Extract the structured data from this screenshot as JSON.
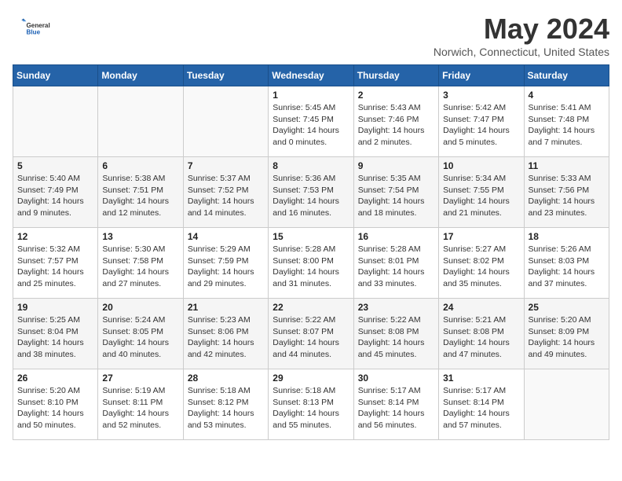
{
  "logo": {
    "general": "General",
    "blue": "Blue"
  },
  "header": {
    "month": "May 2024",
    "location": "Norwich, Connecticut, United States"
  },
  "weekdays": [
    "Sunday",
    "Monday",
    "Tuesday",
    "Wednesday",
    "Thursday",
    "Friday",
    "Saturday"
  ],
  "weeks": [
    [
      {
        "day": "",
        "info": ""
      },
      {
        "day": "",
        "info": ""
      },
      {
        "day": "",
        "info": ""
      },
      {
        "day": "1",
        "info": "Sunrise: 5:45 AM\nSunset: 7:45 PM\nDaylight: 14 hours\nand 0 minutes."
      },
      {
        "day": "2",
        "info": "Sunrise: 5:43 AM\nSunset: 7:46 PM\nDaylight: 14 hours\nand 2 minutes."
      },
      {
        "day": "3",
        "info": "Sunrise: 5:42 AM\nSunset: 7:47 PM\nDaylight: 14 hours\nand 5 minutes."
      },
      {
        "day": "4",
        "info": "Sunrise: 5:41 AM\nSunset: 7:48 PM\nDaylight: 14 hours\nand 7 minutes."
      }
    ],
    [
      {
        "day": "5",
        "info": "Sunrise: 5:40 AM\nSunset: 7:49 PM\nDaylight: 14 hours\nand 9 minutes."
      },
      {
        "day": "6",
        "info": "Sunrise: 5:38 AM\nSunset: 7:51 PM\nDaylight: 14 hours\nand 12 minutes."
      },
      {
        "day": "7",
        "info": "Sunrise: 5:37 AM\nSunset: 7:52 PM\nDaylight: 14 hours\nand 14 minutes."
      },
      {
        "day": "8",
        "info": "Sunrise: 5:36 AM\nSunset: 7:53 PM\nDaylight: 14 hours\nand 16 minutes."
      },
      {
        "day": "9",
        "info": "Sunrise: 5:35 AM\nSunset: 7:54 PM\nDaylight: 14 hours\nand 18 minutes."
      },
      {
        "day": "10",
        "info": "Sunrise: 5:34 AM\nSunset: 7:55 PM\nDaylight: 14 hours\nand 21 minutes."
      },
      {
        "day": "11",
        "info": "Sunrise: 5:33 AM\nSunset: 7:56 PM\nDaylight: 14 hours\nand 23 minutes."
      }
    ],
    [
      {
        "day": "12",
        "info": "Sunrise: 5:32 AM\nSunset: 7:57 PM\nDaylight: 14 hours\nand 25 minutes."
      },
      {
        "day": "13",
        "info": "Sunrise: 5:30 AM\nSunset: 7:58 PM\nDaylight: 14 hours\nand 27 minutes."
      },
      {
        "day": "14",
        "info": "Sunrise: 5:29 AM\nSunset: 7:59 PM\nDaylight: 14 hours\nand 29 minutes."
      },
      {
        "day": "15",
        "info": "Sunrise: 5:28 AM\nSunset: 8:00 PM\nDaylight: 14 hours\nand 31 minutes."
      },
      {
        "day": "16",
        "info": "Sunrise: 5:28 AM\nSunset: 8:01 PM\nDaylight: 14 hours\nand 33 minutes."
      },
      {
        "day": "17",
        "info": "Sunrise: 5:27 AM\nSunset: 8:02 PM\nDaylight: 14 hours\nand 35 minutes."
      },
      {
        "day": "18",
        "info": "Sunrise: 5:26 AM\nSunset: 8:03 PM\nDaylight: 14 hours\nand 37 minutes."
      }
    ],
    [
      {
        "day": "19",
        "info": "Sunrise: 5:25 AM\nSunset: 8:04 PM\nDaylight: 14 hours\nand 38 minutes."
      },
      {
        "day": "20",
        "info": "Sunrise: 5:24 AM\nSunset: 8:05 PM\nDaylight: 14 hours\nand 40 minutes."
      },
      {
        "day": "21",
        "info": "Sunrise: 5:23 AM\nSunset: 8:06 PM\nDaylight: 14 hours\nand 42 minutes."
      },
      {
        "day": "22",
        "info": "Sunrise: 5:22 AM\nSunset: 8:07 PM\nDaylight: 14 hours\nand 44 minutes."
      },
      {
        "day": "23",
        "info": "Sunrise: 5:22 AM\nSunset: 8:08 PM\nDaylight: 14 hours\nand 45 minutes."
      },
      {
        "day": "24",
        "info": "Sunrise: 5:21 AM\nSunset: 8:08 PM\nDaylight: 14 hours\nand 47 minutes."
      },
      {
        "day": "25",
        "info": "Sunrise: 5:20 AM\nSunset: 8:09 PM\nDaylight: 14 hours\nand 49 minutes."
      }
    ],
    [
      {
        "day": "26",
        "info": "Sunrise: 5:20 AM\nSunset: 8:10 PM\nDaylight: 14 hours\nand 50 minutes."
      },
      {
        "day": "27",
        "info": "Sunrise: 5:19 AM\nSunset: 8:11 PM\nDaylight: 14 hours\nand 52 minutes."
      },
      {
        "day": "28",
        "info": "Sunrise: 5:18 AM\nSunset: 8:12 PM\nDaylight: 14 hours\nand 53 minutes."
      },
      {
        "day": "29",
        "info": "Sunrise: 5:18 AM\nSunset: 8:13 PM\nDaylight: 14 hours\nand 55 minutes."
      },
      {
        "day": "30",
        "info": "Sunrise: 5:17 AM\nSunset: 8:14 PM\nDaylight: 14 hours\nand 56 minutes."
      },
      {
        "day": "31",
        "info": "Sunrise: 5:17 AM\nSunset: 8:14 PM\nDaylight: 14 hours\nand 57 minutes."
      },
      {
        "day": "",
        "info": ""
      }
    ]
  ]
}
